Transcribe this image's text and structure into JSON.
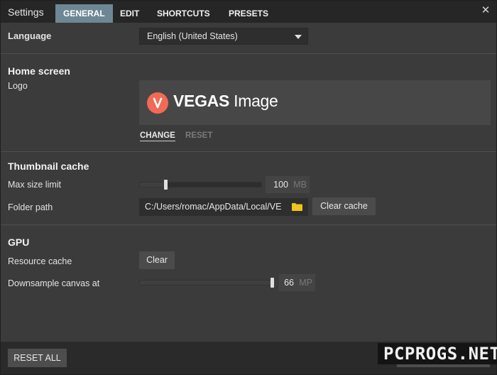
{
  "window": {
    "title": "Settings",
    "close_icon": "close-icon"
  },
  "tabs": [
    {
      "label": "GENERAL",
      "active": true
    },
    {
      "label": "EDIT",
      "active": false
    },
    {
      "label": "SHORTCUTS",
      "active": false
    },
    {
      "label": "PRESETS",
      "active": false
    }
  ],
  "language": {
    "label": "Language",
    "value": "English (United States)"
  },
  "home_screen": {
    "heading": "Home screen",
    "logo_label": "Logo",
    "logo_brand": "VEGAS",
    "logo_product": " Image",
    "change_label": "CHANGE",
    "reset_label": "RESET"
  },
  "thumbnail_cache": {
    "heading": "Thumbnail cache",
    "max_size_label": "Max size limit",
    "max_size_value": "100",
    "max_size_unit": "MB",
    "max_size_level": 0.2,
    "folder_label": "Folder path",
    "folder_value": "C:/Users/romac/AppData/Local/VE",
    "folder_icon": "folder-icon",
    "clear_cache_label": "Clear cache"
  },
  "gpu": {
    "heading": "GPU",
    "resource_cache_label": "Resource cache",
    "clear_label": "Clear",
    "downsample_label": "Downsample canvas at",
    "downsample_value": "66",
    "downsample_unit": "MP",
    "downsample_level": 1.0
  },
  "footer": {
    "reset_all_label": "RESET ALL"
  },
  "watermark": {
    "text": "PCPROGS.NET"
  },
  "colors": {
    "active_tab": "#6e8794",
    "logo_accent": "#f26a55",
    "folder": "#f0c419"
  }
}
